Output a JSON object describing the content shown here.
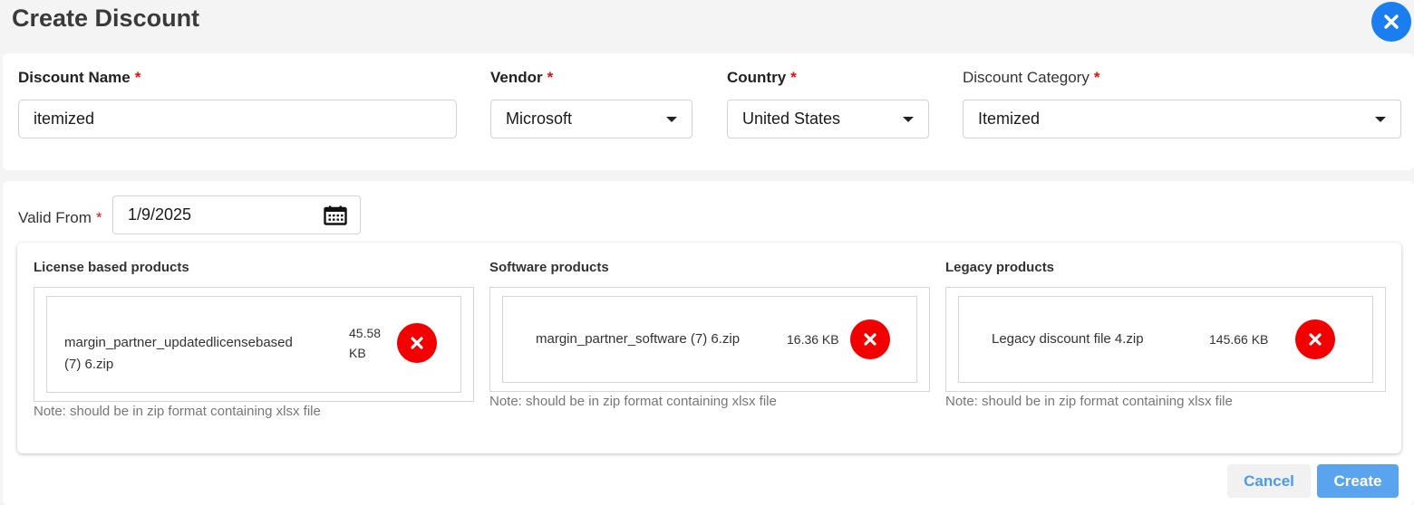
{
  "header": {
    "title": "Create Discount",
    "close_icon": "close-icon"
  },
  "form": {
    "required_mark": "*",
    "discount_name": {
      "label": "Discount Name",
      "value": "itemized"
    },
    "vendor": {
      "label": "Vendor",
      "value": "Microsoft"
    },
    "country": {
      "label": "Country",
      "value": "United States"
    },
    "discount_category": {
      "label": "Discount Category",
      "value": "Itemized"
    },
    "valid_from": {
      "label": "Valid From",
      "value": "1/9/2025",
      "icon": "calendar-icon"
    }
  },
  "uploads": [
    {
      "title": "License based products",
      "file_name_line1": "margin_partner_updatedlicensebased",
      "file_name_line2": "(7) 6.zip",
      "size_value": "45.58",
      "size_unit": "KB",
      "note": "Note: should be in zip format containing xlsx file"
    },
    {
      "title": "Software products",
      "file_name": "margin_partner_software (7) 6.zip",
      "size": "16.36 KB",
      "note": "Note: should be in zip format containing xlsx file"
    },
    {
      "title": "Legacy products",
      "file_name": "Legacy discount file 4.zip",
      "size": "145.66 KB",
      "note": "Note: should be in zip format containing xlsx file"
    }
  ],
  "actions": {
    "cancel_label": "Cancel",
    "create_label": "Create"
  },
  "colors": {
    "accent": "#1a7ef0",
    "danger": "#f20000",
    "required": "#e01010",
    "primary_button": "#5aa3ee"
  }
}
